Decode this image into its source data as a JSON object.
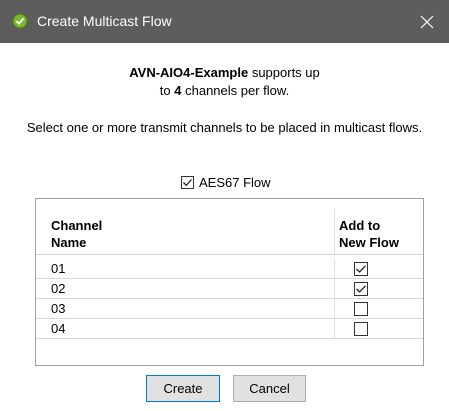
{
  "window": {
    "title": "Create Multicast Flow",
    "close_glyph": "✕",
    "icon": "green-check-shield-icon"
  },
  "message": {
    "device": "AVN-AIO4-Example",
    "supports_text": " supports up",
    "line2_prefix": "to ",
    "channel_count": "4",
    "line2_suffix": " channels per flow.",
    "instruction": "Select one or more transmit channels to be placed in multicast flows."
  },
  "aes67": {
    "label": "AES67 Flow",
    "checked": true
  },
  "table": {
    "headers": {
      "name_line1": "Channel",
      "name_line2": "Name",
      "add_line1": "Add to",
      "add_line2": "New Flow"
    },
    "rows": [
      {
        "name": "01",
        "checked": true
      },
      {
        "name": "02",
        "checked": true
      },
      {
        "name": "03",
        "checked": false
      },
      {
        "name": "04",
        "checked": false
      }
    ]
  },
  "buttons": {
    "create": "Create",
    "cancel": "Cancel"
  },
  "colors": {
    "titlebar": "#5d5d5d",
    "button_focus_border": "#0078d7"
  }
}
